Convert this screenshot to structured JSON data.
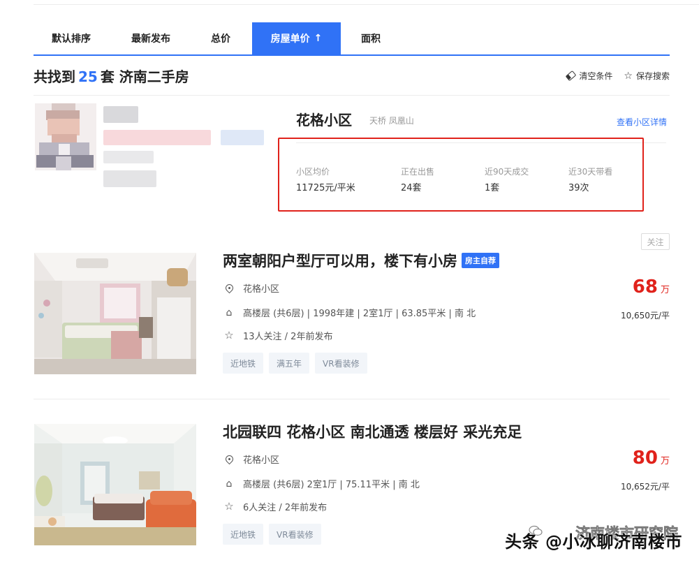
{
  "sort_tabs": [
    {
      "label": "默认排序"
    },
    {
      "label": "最新发布"
    },
    {
      "label": "总价"
    },
    {
      "label": "房屋单价",
      "arrow": "↑",
      "active": true
    },
    {
      "label": "面积"
    }
  ],
  "result": {
    "prefix": "共找到",
    "count": "25",
    "suffix": "套 济南二手房"
  },
  "actions": {
    "clear": "清空条件",
    "save": "保存搜索"
  },
  "community": {
    "name": "花格小区",
    "area": "天桥 凤凰山",
    "link": "查看小区详情",
    "stats": [
      {
        "label": "小区均价",
        "value": "11725元/平米"
      },
      {
        "label": "正在出售",
        "value": "24套"
      },
      {
        "label": "近90天成交",
        "value": "1套"
      },
      {
        "label": "近30天带看",
        "value": "39次"
      }
    ]
  },
  "follow_label": "关注",
  "listings": [
    {
      "title": "两室朝阳户型厅可以用，楼下有小房",
      "badge": "房主自荐",
      "community": "花格小区",
      "house_info": "高楼层 (共6层) | 1998年建 | 2室1厅 | 63.85平米 | 南 北",
      "follow_info": "13人关注 / 2年前发布",
      "tags": [
        "近地铁",
        "满五年",
        "VR看装修"
      ],
      "price": "68",
      "price_unit": "万",
      "unit_price": "10,650元/平"
    },
    {
      "title": "北园联四 花格小区 南北通透 楼层好 采光充足",
      "badge": "",
      "community": "花格小区",
      "house_info": "高楼层 (共6层) 2室1厅 | 75.11平米 | 南 北",
      "follow_info": "6人关注 / 2年前发布",
      "tags": [
        "近地铁",
        "VR看装修"
      ],
      "price": "80",
      "price_unit": "万",
      "unit_price": "10,652元/平"
    }
  ],
  "watermark": {
    "faint": "济南楼市研究院",
    "main": "头条 @小冰聊济南楼市"
  },
  "colors": {
    "accent": "#3072f6",
    "price": "#e0221b",
    "highlight_border": "#e0221b",
    "tag_bg": "#f2f5f9"
  },
  "icons": [
    "arrow-up-icon",
    "eraser-icon",
    "star-icon",
    "pin-icon",
    "house-icon",
    "wechat-icon"
  ]
}
